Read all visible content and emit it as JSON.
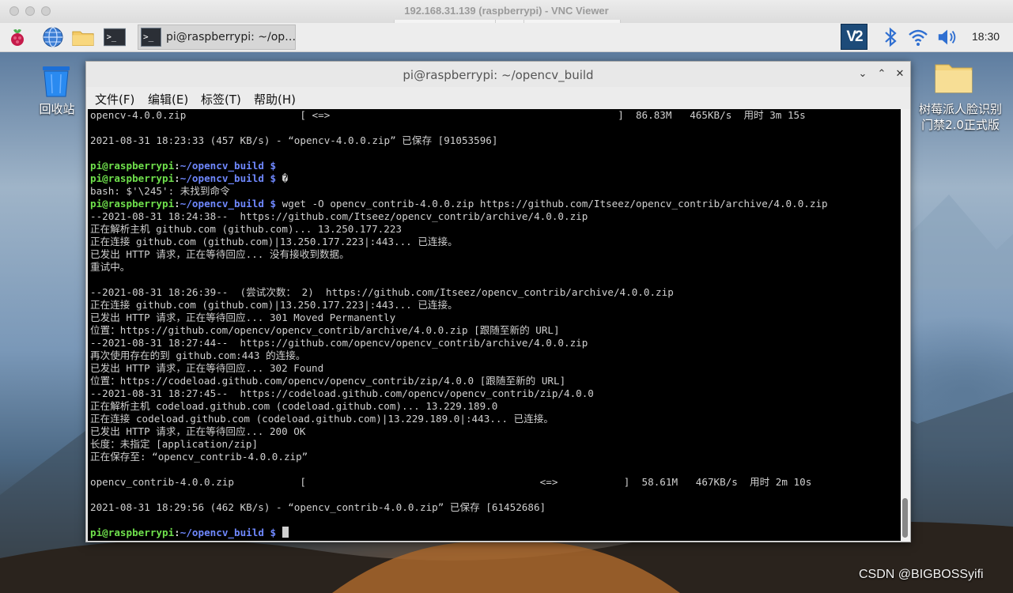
{
  "vnc": {
    "title": "192.168.31.139 (raspberrypi) - VNC Viewer"
  },
  "panel": {
    "launchers": [
      "raspberry-menu-icon",
      "web-browser-icon",
      "file-manager-icon",
      "terminal-icon"
    ],
    "task_label": "pi@raspberrypi: ~/op…",
    "tray": {
      "vnc_label": "V2",
      "icons": [
        "bluetooth-icon",
        "wifi-icon",
        "volume-icon"
      ],
      "clock": "18:30"
    }
  },
  "desktop": {
    "trash_label": "回收站",
    "folder_label_line1": "树莓派人脸识别",
    "folder_label_line2": "门禁2.0正式版",
    "watermark": "CSDN @BIGBOSSyifi"
  },
  "terminal": {
    "title": "pi@raspberrypi: ~/opencv_build",
    "menu": [
      "文件(F)",
      "编辑(E)",
      "标签(T)",
      "帮助(H)"
    ],
    "prompt": {
      "user": "pi@raspberrypi",
      "path": "~/opencv_build",
      "symbol": "$"
    },
    "lines": [
      {
        "kind": "out",
        "text": "opencv-4.0.0.zip                   [ <=>                                                ]  86.83M   465KB/s  用时 3m 15s"
      },
      {
        "kind": "out",
        "text": ""
      },
      {
        "kind": "out",
        "text": "2021-08-31 18:23:33 (457 KB/s) - “opencv-4.0.0.zip” 已保存 [91053596]"
      },
      {
        "kind": "out",
        "text": ""
      },
      {
        "kind": "prompt",
        "text": ""
      },
      {
        "kind": "prompt",
        "text": "�"
      },
      {
        "kind": "out",
        "text": "bash: $'\\245': 未找到命令"
      },
      {
        "kind": "prompt",
        "text": "wget -O opencv_contrib-4.0.0.zip https://github.com/Itseez/opencv_contrib/archive/4.0.0.zip"
      },
      {
        "kind": "out",
        "text": "--2021-08-31 18:24:38--  https://github.com/Itseez/opencv_contrib/archive/4.0.0.zip"
      },
      {
        "kind": "out",
        "text": "正在解析主机 github.com (github.com)... 13.250.177.223"
      },
      {
        "kind": "out",
        "text": "正在连接 github.com (github.com)|13.250.177.223|:443... 已连接。"
      },
      {
        "kind": "out",
        "text": "已发出 HTTP 请求，正在等待回应... 没有接收到数据。"
      },
      {
        "kind": "out",
        "text": "重试中。"
      },
      {
        "kind": "out",
        "text": ""
      },
      {
        "kind": "out",
        "text": "--2021-08-31 18:26:39--  (尝试次数： 2)  https://github.com/Itseez/opencv_contrib/archive/4.0.0.zip"
      },
      {
        "kind": "out",
        "text": "正在连接 github.com (github.com)|13.250.177.223|:443... 已连接。"
      },
      {
        "kind": "out",
        "text": "已发出 HTTP 请求，正在等待回应... 301 Moved Permanently"
      },
      {
        "kind": "out",
        "text": "位置：https://github.com/opencv/opencv_contrib/archive/4.0.0.zip [跟随至新的 URL]"
      },
      {
        "kind": "out",
        "text": "--2021-08-31 18:27:44--  https://github.com/opencv/opencv_contrib/archive/4.0.0.zip"
      },
      {
        "kind": "out",
        "text": "再次使用存在的到 github.com:443 的连接。"
      },
      {
        "kind": "out",
        "text": "已发出 HTTP 请求，正在等待回应... 302 Found"
      },
      {
        "kind": "out",
        "text": "位置：https://codeload.github.com/opencv/opencv_contrib/zip/4.0.0 [跟随至新的 URL]"
      },
      {
        "kind": "out",
        "text": "--2021-08-31 18:27:45--  https://codeload.github.com/opencv/opencv_contrib/zip/4.0.0"
      },
      {
        "kind": "out",
        "text": "正在解析主机 codeload.github.com (codeload.github.com)... 13.229.189.0"
      },
      {
        "kind": "out",
        "text": "正在连接 codeload.github.com (codeload.github.com)|13.229.189.0|:443... 已连接。"
      },
      {
        "kind": "out",
        "text": "已发出 HTTP 请求，正在等待回应... 200 OK"
      },
      {
        "kind": "out",
        "text": "长度：未指定 [application/zip]"
      },
      {
        "kind": "out",
        "text": "正在保存至: “opencv_contrib-4.0.0.zip”"
      },
      {
        "kind": "out",
        "text": ""
      },
      {
        "kind": "out",
        "text": "opencv_contrib-4.0.0.zip           [                                       <=>           ]  58.61M   467KB/s  用时 2m 10s"
      },
      {
        "kind": "out",
        "text": ""
      },
      {
        "kind": "out",
        "text": "2021-08-31 18:29:56 (462 KB/s) - “opencv_contrib-4.0.0.zip” 已保存 [61452686]"
      },
      {
        "kind": "out",
        "text": ""
      },
      {
        "kind": "prompt-cursor",
        "text": ""
      }
    ]
  }
}
